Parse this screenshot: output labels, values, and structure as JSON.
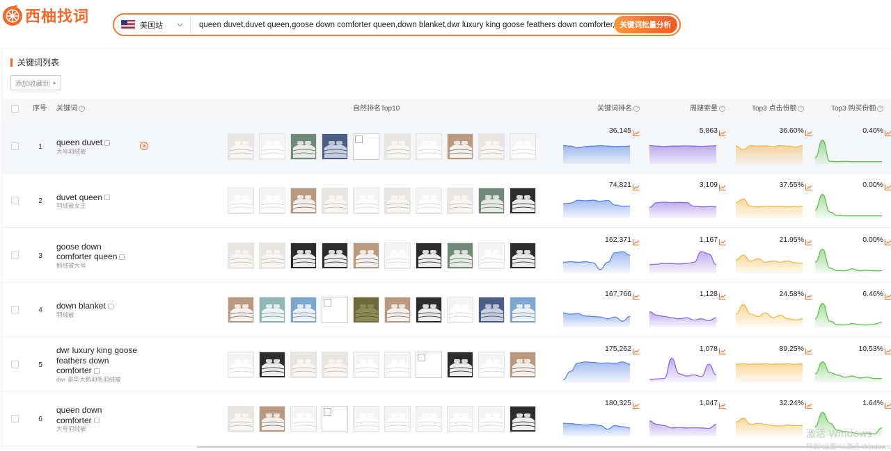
{
  "app": {
    "name": "西柚找词"
  },
  "search": {
    "site": "美国站",
    "query": "queen duvet,duvet queen,goose down comforter queen,down blanket,dwr luxury king goose feathers down comforter,c",
    "analyze_label": "关键词批量分析"
  },
  "section": {
    "title": "关键词列表",
    "fav_label": "添加收藏到"
  },
  "table": {
    "headers": {
      "index": "序号",
      "keyword": "关键词",
      "top10": "自然排名Top10",
      "rank": "关键词排名",
      "weekly": "周搜索量",
      "click": "Top3 点击份额",
      "buy": "Top3 购买份额"
    },
    "rows": [
      {
        "index": "1",
        "kw_lines": [
          "queen duvet"
        ],
        "cn": "大号羽绒被",
        "rank": "36,145",
        "weekly": "5,863",
        "click": "36.60%",
        "buy": "0.40%",
        "amazon": true,
        "thumbs": [
          "light",
          "white",
          "green",
          "navy",
          "empty",
          "light",
          "white",
          "tan",
          "light",
          "white"
        ],
        "spark_rank": [
          0.72,
          0.7,
          0.62,
          0.68,
          0.7,
          0.72,
          0.7,
          0.68,
          0.69,
          0.7
        ],
        "spark_weekly": [
          0.72,
          0.7,
          0.68,
          0.7,
          0.7,
          0.71,
          0.7,
          0.69,
          0.7,
          0.72
        ],
        "spark_click": [
          0.7,
          0.55,
          0.72,
          0.7,
          0.71,
          0.68,
          0.72,
          0.7,
          0.66,
          0.72
        ],
        "spark_buy": [
          0.2,
          0.95,
          0.05,
          0.04,
          0.05,
          0.04,
          0.04,
          0.04,
          0.04,
          0.04
        ]
      },
      {
        "index": "2",
        "kw_lines": [
          "duvet queen"
        ],
        "cn": "羽绒被女王",
        "rank": "74,821",
        "weekly": "3,109",
        "click": "37.55%",
        "buy": "0.00%",
        "amazon": false,
        "thumbs": [
          "white",
          "white",
          "tan",
          "light",
          "white",
          "light",
          "white",
          "light",
          "green",
          "dark"
        ],
        "spark_rank": [
          0.55,
          0.58,
          0.7,
          0.68,
          0.7,
          0.66,
          0.69,
          0.5,
          0.45,
          0.46
        ],
        "spark_weekly": [
          0.4,
          0.6,
          0.62,
          0.6,
          0.61,
          0.6,
          0.45,
          0.42,
          0.43,
          0.44
        ],
        "spark_click": [
          0.6,
          0.75,
          0.45,
          0.42,
          0.45,
          0.43,
          0.44,
          0.42,
          0.44,
          0.45
        ],
        "spark_buy": [
          0.3,
          0.95,
          0.2,
          0.05,
          0.04,
          0.04,
          0.04,
          0.04,
          0.04,
          0.04
        ]
      },
      {
        "index": "3",
        "kw_lines": [
          "goose down",
          "comforter queen"
        ],
        "cn": "鹅绒被大号",
        "rank": "162,371",
        "weekly": "1,167",
        "click": "21.95%",
        "buy": "0.00%",
        "amazon": false,
        "thumbs": [
          "light",
          "light",
          "dark",
          "dark",
          "tan",
          "white",
          "dark",
          "green",
          "white",
          "dark"
        ],
        "spark_rank": [
          0.4,
          0.42,
          0.4,
          0.42,
          0.38,
          0.1,
          0.4,
          0.8,
          0.85,
          0.7
        ],
        "spark_weekly": [
          0.3,
          0.32,
          0.35,
          0.34,
          0.33,
          0.35,
          0.4,
          0.85,
          0.75,
          0.3
        ],
        "spark_click": [
          0.5,
          0.7,
          0.45,
          0.55,
          0.4,
          0.45,
          0.4,
          0.45,
          0.38,
          0.35
        ],
        "spark_buy": [
          0.4,
          0.95,
          0.15,
          0.05,
          0.04,
          0.12,
          0.04,
          0.06,
          0.04,
          0.04
        ]
      },
      {
        "index": "4",
        "kw_lines": [
          "down blanket"
        ],
        "cn": "羽绒被",
        "rank": "167,766",
        "weekly": "1,128",
        "click": "24.58%",
        "buy": "6.46%",
        "amazon": false,
        "thumbs": [
          "tan",
          "teal",
          "blue",
          "empty",
          "olive",
          "tan",
          "dark",
          "white",
          "navy",
          "blue"
        ],
        "spark_rank": [
          0.55,
          0.5,
          0.52,
          0.42,
          0.4,
          0.38,
          0.3,
          0.38,
          0.2,
          0.4
        ],
        "spark_weekly": [
          0.6,
          0.45,
          0.4,
          0.35,
          0.3,
          0.35,
          0.25,
          0.3,
          0.22,
          0.35
        ],
        "spark_click": [
          0.5,
          0.9,
          0.5,
          0.4,
          0.55,
          0.35,
          0.45,
          0.3,
          0.25,
          0.3
        ],
        "spark_buy": [
          0.3,
          0.95,
          0.2,
          0.05,
          0.04,
          0.1,
          0.05,
          0.04,
          0.08,
          0.15
        ]
      },
      {
        "index": "5",
        "kw_lines": [
          "dwr luxury king goose",
          "feathers down",
          "comforter"
        ],
        "cn": "dwr 豪华大鹅羽毛羽绒被",
        "rank": "175,262",
        "weekly": "1,078",
        "click": "89.25%",
        "buy": "10.53%",
        "amazon": false,
        "thumbs": [
          "white",
          "dark",
          "light",
          "light",
          "white",
          "white",
          "empty",
          "dark",
          "white",
          "tan"
        ],
        "spark_rank": [
          0.05,
          0.4,
          0.75,
          0.8,
          0.78,
          0.75,
          0.76,
          0.74,
          0.8,
          0.7
        ],
        "spark_weekly": [
          0.05,
          0.08,
          0.1,
          0.95,
          0.3,
          0.2,
          0.25,
          0.18,
          0.7,
          0.25
        ],
        "spark_click": [
          0.7,
          0.72,
          0.7,
          0.71,
          0.72,
          0.7,
          0.71,
          0.72,
          0.7,
          0.72
        ],
        "spark_buy": [
          0.3,
          0.8,
          0.35,
          0.25,
          0.15,
          0.2,
          0.12,
          0.15,
          0.1,
          0.1
        ]
      },
      {
        "index": "6",
        "kw_lines": [
          "queen down",
          "comforter"
        ],
        "cn": "大号羽绒被",
        "rank": "180,325",
        "weekly": "1,047",
        "click": "32.24%",
        "buy": "1.64%",
        "amazon": false,
        "thumbs": [
          "light",
          "tan",
          "white",
          "empty",
          "white",
          "white",
          "white",
          "white",
          "white",
          "dark"
        ],
        "spark_rank": [
          0.5,
          0.48,
          0.45,
          0.42,
          0.45,
          0.4,
          0.25,
          0.4,
          0.35,
          0.3
        ],
        "spark_weekly": [
          0.6,
          0.45,
          0.4,
          0.3,
          0.32,
          0.3,
          0.31,
          0.3,
          0.28,
          0.45
        ],
        "spark_click": [
          0.55,
          0.7,
          0.45,
          0.5,
          0.45,
          0.4,
          0.38,
          0.42,
          0.4,
          0.4
        ],
        "spark_buy": [
          0.35,
          0.95,
          0.5,
          0.2,
          0.15,
          0.1,
          0.05,
          0.08,
          0.05,
          0.3
        ]
      }
    ]
  },
  "colors": {
    "brand": "#f06a2a",
    "rank": "#5b86e5",
    "weekly": "#8c6be0",
    "click": "#f2b84b",
    "buy": "#5fbf4f"
  },
  "watermark": {
    "line1": "激活 Windows",
    "line2": "转到\"设置\"以激活 Windows。"
  }
}
